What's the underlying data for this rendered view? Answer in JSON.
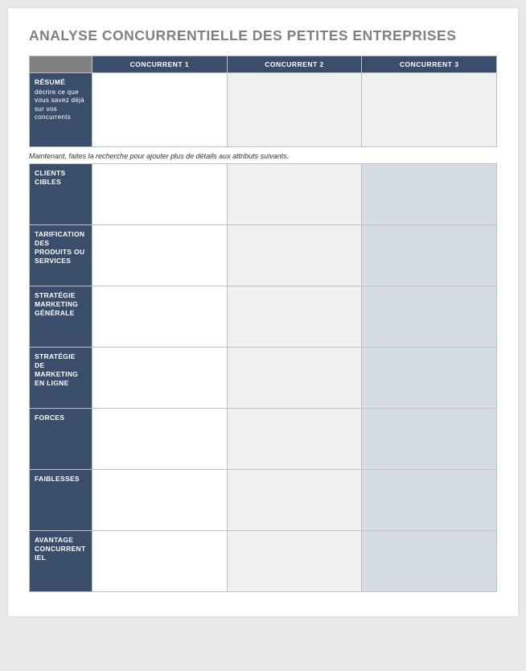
{
  "title": "ANALYSE CONCURRENTIELLE DES PETITES ENTREPRISES",
  "columns": {
    "c1": "CONCURRENT 1",
    "c2": "CONCURRENT 2",
    "c3": "CONCURRENT 3"
  },
  "summary": {
    "label": "RÉSUMÉ",
    "sub": "décrire ce que vous savez déjà sur vos concurrents"
  },
  "instruction": "Maintenant, faites la recherche pour ajouter plus de détails aux attributs suivants.",
  "rows": {
    "r1": "CLIENTS CIBLES",
    "r2": "TARIFICATION DES PRODUITS OU SERVICES",
    "r3": "STRATÉGIE MARKETING GÉNÉRALE",
    "r4": "STRATÉGIE DE MARKETING EN LIGNE",
    "r5": "FORCES",
    "r6": "FAIBLESSES",
    "r7": "AVANTAGE CONCURRENTIEL"
  }
}
